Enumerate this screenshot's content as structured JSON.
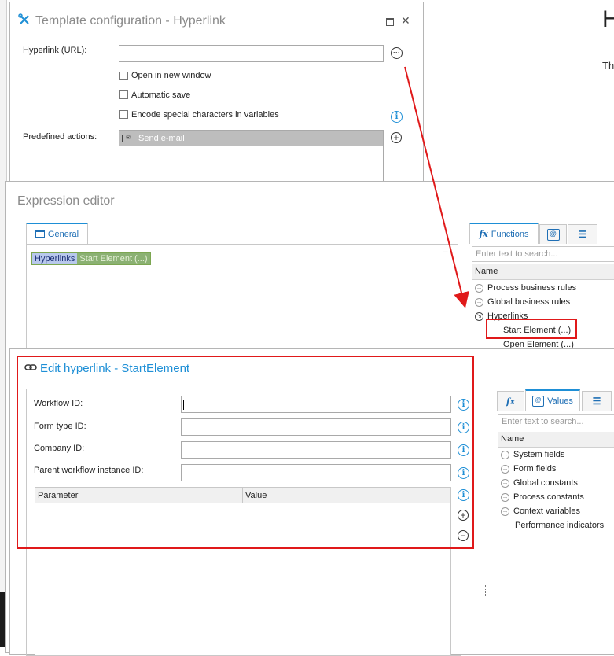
{
  "template_config": {
    "title": "Template configuration - Hyperlink",
    "hyperlink_label": "Hyperlink (URL):",
    "hyperlink_value": "",
    "open_new_window": "Open in new window",
    "automatic_save": "Automatic save",
    "encode_special": "Encode special characters in variables",
    "predefined_label": "Predefined actions:",
    "predefined_item": "Send e-mail"
  },
  "expression_editor": {
    "title": "Expression editor",
    "general_tab": "General",
    "token_hyperlinks": "Hyperlinks",
    "token_start": "Start Element (...)",
    "functions_tab": "Functions",
    "search_placeholder": "Enter text to search...",
    "name_header": "Name",
    "tree": {
      "process_rules": "Process business rules",
      "global_rules": "Global business rules",
      "hyperlinks": "Hyperlinks",
      "start_element": "Start Element (...)",
      "open_element": "Open Element (...)"
    }
  },
  "edit_hyperlink": {
    "title": "Edit hyperlink - StartElement",
    "workflow_id": "Workflow ID:",
    "form_type_id": "Form type ID:",
    "company_id": "Company ID:",
    "parent_instance_id": "Parent workflow instance ID:",
    "col_parameter": "Parameter",
    "col_value": "Value",
    "values_tab": "Values",
    "search_placeholder": "Enter text to search...",
    "name_header": "Name",
    "tree": {
      "system_fields": "System fields",
      "form_fields": "Form fields",
      "global_constants": "Global constants",
      "process_constants": "Process constants",
      "context_variables": "Context variables",
      "performance_indicators": "Performance indicators"
    }
  },
  "background_page": {
    "heading_letter": "H",
    "text_fragment": "Th"
  },
  "colors": {
    "accent_blue": "#1e8fd6",
    "highlight_red": "#e0191a",
    "title_gray": "#8a8a8a"
  }
}
